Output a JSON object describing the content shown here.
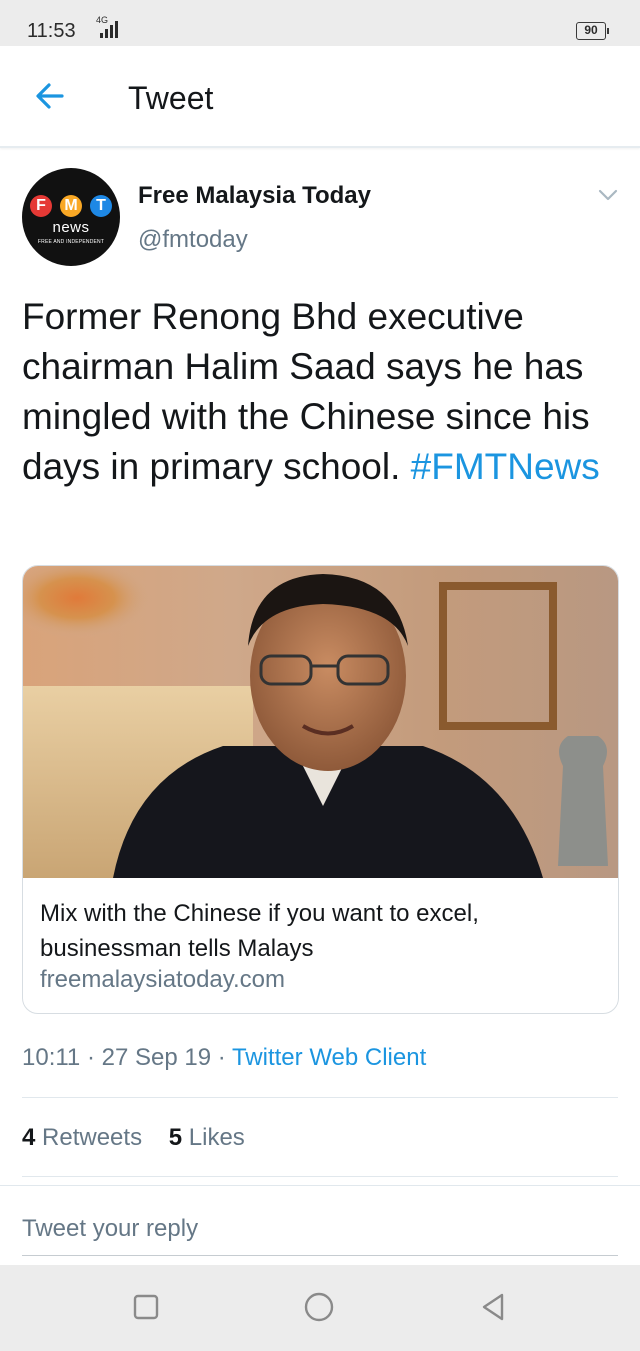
{
  "status_bar": {
    "time": "11:53",
    "network": "4G",
    "battery": "90"
  },
  "header": {
    "back_icon": "arrow-left-icon",
    "title": "Tweet"
  },
  "tweet": {
    "author": {
      "name": "Free Malaysia Today",
      "handle": "@fmtoday",
      "avatar": {
        "letters": [
          "F",
          "M",
          "T"
        ],
        "letter_colors": [
          "#e53935",
          "#f9a825",
          "#1e88e5"
        ],
        "word": "news",
        "tagline": "FREE AND INDEPENDENT"
      }
    },
    "text": "Former Renong Bhd executive chairman Halim Saad says he has mingled with the Chinese since his days in primary school.",
    "hashtag": "#FMTNews",
    "card": {
      "title": "Mix with the Chinese if you want to excel, businessman tells Malays",
      "domain": "freemalaysiatoday.com"
    },
    "meta": {
      "time": "10:11",
      "sep1": "·",
      "date": "27 Sep 19",
      "sep2": "·",
      "client": "Twitter Web Client"
    },
    "stats": {
      "retweets_count": "4",
      "retweets_label": "Retweets",
      "likes_count": "5",
      "likes_label": "Likes"
    }
  },
  "reply": {
    "placeholder": "Tweet your reply"
  },
  "navbar": {
    "items": [
      "recent-apps-icon",
      "home-icon",
      "back-icon"
    ]
  },
  "colors": {
    "link": "#1b95e0",
    "secondary_text": "#657786",
    "divider": "#e1e8ed"
  }
}
